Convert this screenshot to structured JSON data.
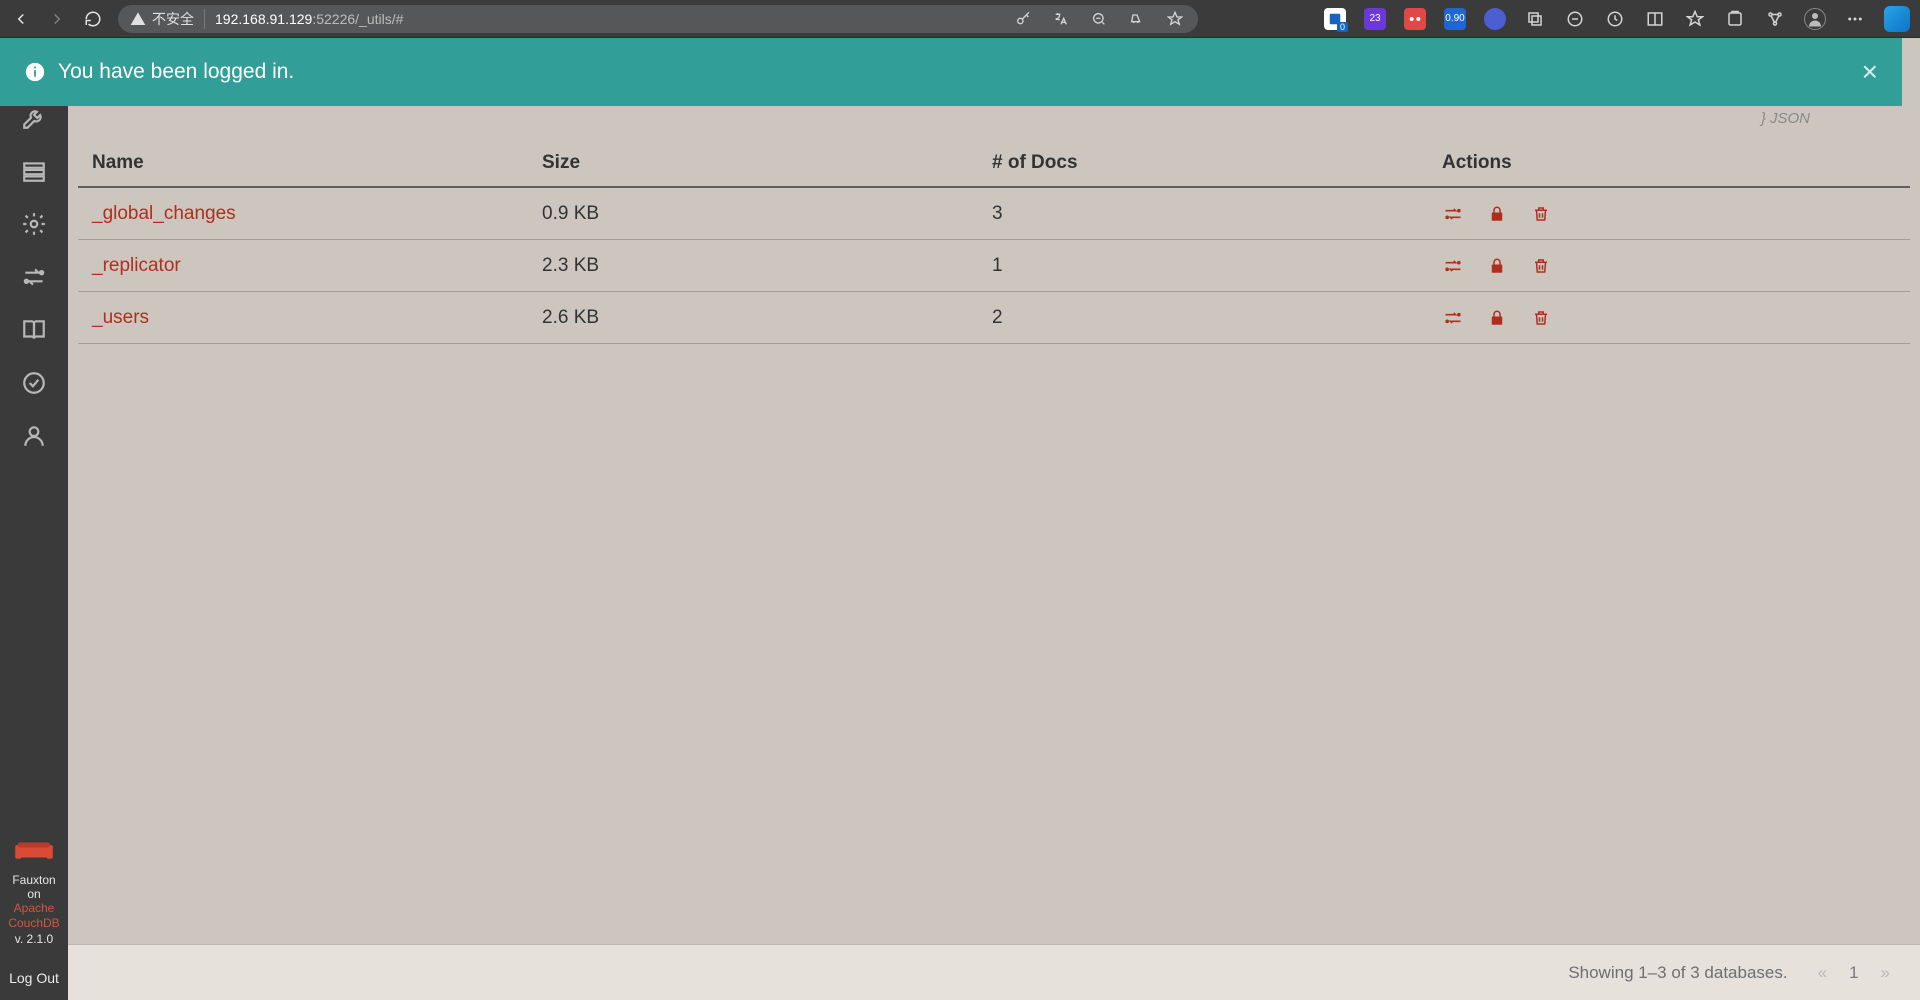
{
  "chrome": {
    "security_label": "不安全",
    "url_host": "192.168.91.129",
    "url_rest": ":52226/_utils/#",
    "ext_badges": [
      "0",
      "23",
      "",
      "0.90"
    ]
  },
  "banner": {
    "message": "You have been logged in."
  },
  "json_cut_label": "} JSON",
  "rail": {
    "footer_line1": "Fauxton on",
    "footer_apache": "Apache",
    "footer_couch": "CouchDB",
    "footer_version": "v. 2.1.0",
    "logout": "Log Out"
  },
  "table": {
    "columns": {
      "name": "Name",
      "size": "Size",
      "docs": "# of Docs",
      "actions": "Actions"
    },
    "rows": [
      {
        "name": "_global_changes",
        "size": "0.9 KB",
        "docs": "3"
      },
      {
        "name": "_replicator",
        "size": "2.3 KB",
        "docs": "1"
      },
      {
        "name": "_users",
        "size": "2.6 KB",
        "docs": "2"
      }
    ]
  },
  "footer": {
    "showing": "Showing 1–3 of 3 databases.",
    "page": "1"
  }
}
